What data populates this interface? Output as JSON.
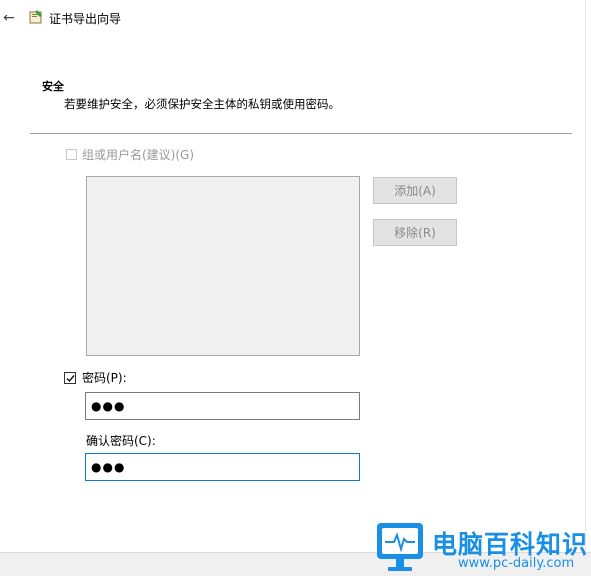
{
  "window": {
    "title": "证书导出向导"
  },
  "section": {
    "heading": "安全",
    "description": "若要维护安全，必须保护安全主体的私钥或使用密码。"
  },
  "group_option": {
    "label": "组或用户名(建议)(G)",
    "checked": false,
    "enabled": false
  },
  "principal_list": {
    "items": []
  },
  "buttons": {
    "add_label": "添加(A)",
    "remove_label": "移除(R)"
  },
  "password": {
    "label": "密码(P):",
    "checked": true,
    "value": "●●●",
    "confirm_label": "确认密码(C):",
    "confirm_value": "●●●"
  },
  "watermark": {
    "text": "电脑百科知识",
    "url": "www.pc-daily.com"
  },
  "colors": {
    "accent": "#0f78d7",
    "watermark": "#1a8fe6"
  }
}
